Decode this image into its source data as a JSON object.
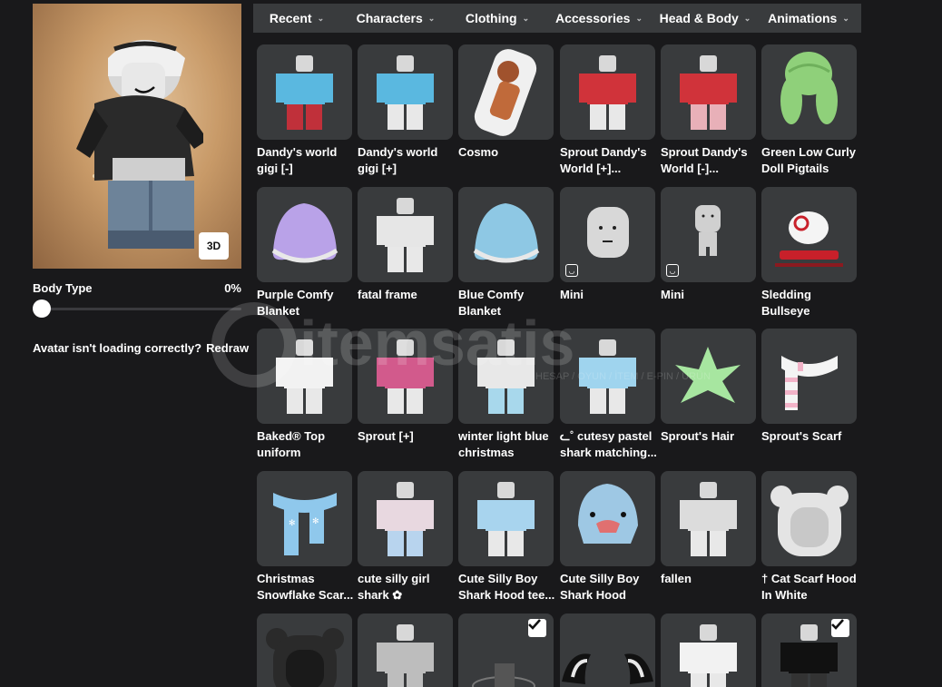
{
  "avatar": {
    "view_3d_label": "3D"
  },
  "body_type": {
    "label": "Body Type",
    "value": "0%",
    "level": 0
  },
  "reload": {
    "text": "Avatar isn't loading correctly?",
    "link": "Redraw"
  },
  "tabs": [
    {
      "label": "Recent"
    },
    {
      "label": "Characters"
    },
    {
      "label": "Clothing"
    },
    {
      "label": "Accessories"
    },
    {
      "label": "Head & Body"
    },
    {
      "label": "Animations"
    }
  ],
  "watermark": {
    "text": "itemsatis",
    "subtext": "HESAP / OYUN / İTEM / E-PIN / ÜRÜN"
  },
  "items": [
    {
      "line1": "Dandy's world",
      "line2": "gigi [-]",
      "icon": "shirt-avatar-icon",
      "accent": "#5ab8e0",
      "pants": "#c0303a",
      "checked": false,
      "dynamic": false
    },
    {
      "line1": "Dandy's world",
      "line2": "gigi [+]",
      "icon": "shirt-avatar-icon",
      "accent": "#5ab8e0",
      "pants": "#e8e8e8",
      "checked": false,
      "dynamic": false
    },
    {
      "line1": "Cosmo",
      "line2": "",
      "icon": "body-pillow-icon",
      "accent": "#a0522d",
      "pants": "",
      "checked": false,
      "dynamic": false
    },
    {
      "line1": "Sprout Dandy's",
      "line2": "World [+]...",
      "icon": "shirt-avatar-icon",
      "accent": "#d0333a",
      "pants": "#e8e8e8",
      "checked": false,
      "dynamic": false
    },
    {
      "line1": "Sprout Dandy's",
      "line2": "World [-]...",
      "icon": "shirt-avatar-icon",
      "accent": "#d0333a",
      "pants": "#e8b0b8",
      "checked": false,
      "dynamic": false
    },
    {
      "line1": "Green Low Curly",
      "line2": "Doll Pigtails",
      "icon": "hair-icon",
      "accent": "#8fd07a",
      "pants": "",
      "checked": false,
      "dynamic": false
    },
    {
      "line1": "Purple Comfy",
      "line2": "Blanket",
      "icon": "blanket-icon",
      "accent": "#b9a2e8",
      "pants": "",
      "checked": false,
      "dynamic": false
    },
    {
      "line1": "fatal frame",
      "line2": "",
      "icon": "shirt-avatar-icon",
      "accent": "#e6e6e6",
      "pants": "#e8e8e8",
      "checked": false,
      "dynamic": false
    },
    {
      "line1": "Blue Comfy",
      "line2": "Blanket",
      "icon": "blanket-icon",
      "accent": "#8ec8e4",
      "pants": "",
      "checked": false,
      "dynamic": false
    },
    {
      "line1": "Mini",
      "line2": "",
      "icon": "head-icon",
      "accent": "#cfcfcf",
      "pants": "",
      "checked": false,
      "dynamic": true
    },
    {
      "line1": "Mini",
      "line2": "",
      "icon": "mini-body-icon",
      "accent": "#cfcfcf",
      "pants": "",
      "checked": false,
      "dynamic": true
    },
    {
      "line1": "Sledding",
      "line2": "Bullseye",
      "icon": "sled-dog-icon",
      "accent": "#c8202a",
      "pants": "",
      "checked": false,
      "dynamic": false
    },
    {
      "line1": "Baked® Top",
      "line2": "uniform",
      "icon": "shirt-avatar-icon",
      "accent": "#f2f2f2",
      "pants": "#e8e8e8",
      "checked": false,
      "dynamic": false
    },
    {
      "line1": "Sprout [+]",
      "line2": "",
      "icon": "shirt-avatar-icon",
      "accent": "#d25a8c",
      "pants": "#e8e8e8",
      "checked": false,
      "dynamic": false
    },
    {
      "line1": "winter light blue",
      "line2": "christmas",
      "icon": "shirt-avatar-icon",
      "accent": "#e8e8e8",
      "pants": "#a8d8ec",
      "checked": false,
      "dynamic": false
    },
    {
      "line1": "ᓚ˚ cutesy pastel",
      "line2": "shark matching...",
      "icon": "shirt-avatar-icon",
      "accent": "#9fd4ee",
      "pants": "#e8e8e8",
      "checked": false,
      "dynamic": false
    },
    {
      "line1": "Sprout's Hair",
      "line2": "",
      "icon": "leaf-hair-icon",
      "accent": "#a7e6a0",
      "pants": "",
      "checked": false,
      "dynamic": false
    },
    {
      "line1": "Sprout's Scarf",
      "line2": "",
      "icon": "scarf-icon",
      "accent": "#f2b3c8",
      "pants": "",
      "checked": false,
      "dynamic": false
    },
    {
      "line1": "Christmas",
      "line2": "Snowflake Scar...",
      "icon": "snowflake-scarf-icon",
      "accent": "#8fc8ec",
      "pants": "",
      "checked": false,
      "dynamic": false
    },
    {
      "line1": "cute silly girl",
      "line2": "shark ✿",
      "icon": "shirt-avatar-icon",
      "accent": "#e8d8e0",
      "pants": "#b8d4ee",
      "checked": false,
      "dynamic": false
    },
    {
      "line1": "Cute Silly Boy",
      "line2": "Shark Hood tee...",
      "icon": "shirt-avatar-icon",
      "accent": "#a8d4ee",
      "pants": "#e8e8e8",
      "checked": false,
      "dynamic": false
    },
    {
      "line1": "Cute Silly Boy",
      "line2": "Shark Hood",
      "icon": "shark-hood-icon",
      "accent": "#9ec8e4",
      "pants": "",
      "checked": false,
      "dynamic": false
    },
    {
      "line1": "fallen",
      "line2": "",
      "icon": "shirt-avatar-icon",
      "accent": "#dcdcdc",
      "pants": "#e8e8e8",
      "checked": false,
      "dynamic": false
    },
    {
      "line1": "† Cat Scarf Hood",
      "line2": "In White",
      "icon": "cat-hood-icon",
      "accent": "#e4e4e4",
      "pants": "",
      "checked": false,
      "dynamic": false
    },
    {
      "line1": "",
      "line2": "",
      "icon": "cat-hood-icon",
      "accent": "#2a2a2a",
      "pants": "",
      "checked": false,
      "dynamic": false
    },
    {
      "line1": "",
      "line2": "",
      "icon": "shirt-avatar-icon",
      "accent": "#bdbdbd",
      "pants": "#bdbdbd",
      "checked": false,
      "dynamic": false
    },
    {
      "line1": "",
      "line2": "",
      "icon": "halo-icon",
      "accent": "#555555",
      "pants": "",
      "checked": true,
      "dynamic": false
    },
    {
      "line1": "",
      "line2": "",
      "icon": "ears-icon",
      "accent": "#111111",
      "pants": "",
      "checked": false,
      "dynamic": false
    },
    {
      "line1": "",
      "line2": "",
      "icon": "shirt-avatar-icon",
      "accent": "#f2f2f2",
      "pants": "#e8e8e8",
      "checked": false,
      "dynamic": false
    },
    {
      "line1": "",
      "line2": "",
      "icon": "shirt-avatar-icon",
      "accent": "#111111",
      "pants": "#333333",
      "checked": true,
      "dynamic": false
    }
  ]
}
